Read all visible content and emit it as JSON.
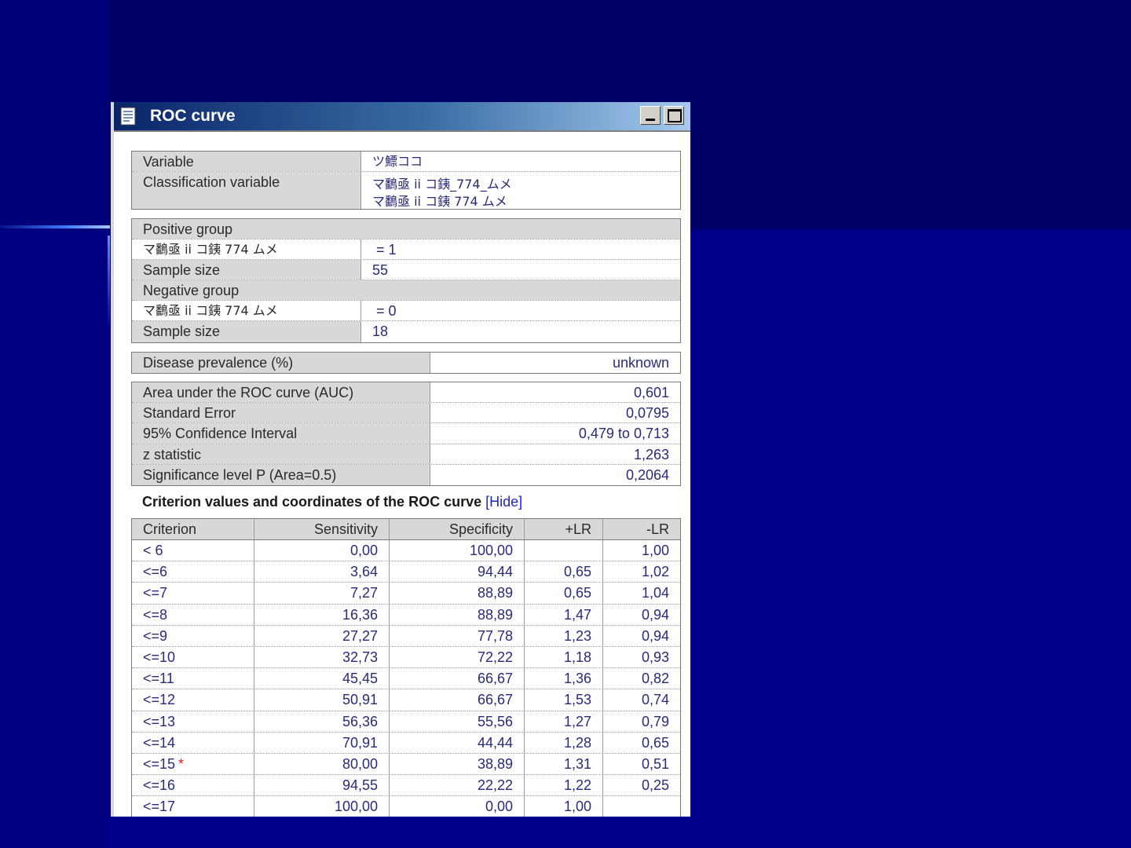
{
  "window": {
    "title": "ROC curve"
  },
  "info": {
    "variable_label": "Variable",
    "variable_value": "ツ鰾ココ",
    "class_label": "Classification variable",
    "class_value_1": "マ鷭亟 ii コ銕_774_ムメ",
    "class_value_2": "マ鷭亟 ii コ銕 774 ムメ"
  },
  "groups": {
    "positive_label": "Positive group",
    "positive_var": "マ鷭亟 ii コ銕 774 ムメ",
    "positive_cond": " = 1",
    "positive_size_label": "Sample size",
    "positive_size": "55",
    "negative_label": "Negative group",
    "negative_var": "マ鷭亟 ii コ銕 774 ムメ",
    "negative_cond": " = 0",
    "negative_size_label": "Sample size",
    "negative_size": "18"
  },
  "prevalence": {
    "label": "Disease prevalence (%)",
    "value": "unknown"
  },
  "stats": [
    {
      "label": "Area under the ROC curve (AUC)",
      "value": "0,601"
    },
    {
      "label": "Standard Error",
      "value": "0,0795"
    },
    {
      "label": "95% Confidence Interval",
      "value": "0,479 to 0,713"
    },
    {
      "label": "z statistic",
      "value": "1,263"
    },
    {
      "label": "Significance level P (Area=0.5)",
      "value": "0,2064"
    }
  ],
  "criterion_section": {
    "heading": "Criterion values and coordinates of the ROC curve",
    "hide_link": "[Hide]"
  },
  "criterion_table": {
    "headers": [
      "Criterion",
      "Sensitivity",
      "Specificity",
      "+LR",
      "-LR"
    ],
    "rows": [
      {
        "criterion": "< 6",
        "star": "",
        "sens": "0,00",
        "spec": "100,00",
        "plr": "",
        "nlr": "1,00"
      },
      {
        "criterion": "<=6",
        "star": "",
        "sens": "3,64",
        "spec": "94,44",
        "plr": "0,65",
        "nlr": "1,02"
      },
      {
        "criterion": "<=7",
        "star": "",
        "sens": "7,27",
        "spec": "88,89",
        "plr": "0,65",
        "nlr": "1,04"
      },
      {
        "criterion": "<=8",
        "star": "",
        "sens": "16,36",
        "spec": "88,89",
        "plr": "1,47",
        "nlr": "0,94"
      },
      {
        "criterion": "<=9",
        "star": "",
        "sens": "27,27",
        "spec": "77,78",
        "plr": "1,23",
        "nlr": "0,94"
      },
      {
        "criterion": "<=10",
        "star": "",
        "sens": "32,73",
        "spec": "72,22",
        "plr": "1,18",
        "nlr": "0,93"
      },
      {
        "criterion": "<=11",
        "star": "",
        "sens": "45,45",
        "spec": "66,67",
        "plr": "1,36",
        "nlr": "0,82"
      },
      {
        "criterion": "<=12",
        "star": "",
        "sens": "50,91",
        "spec": "66,67",
        "plr": "1,53",
        "nlr": "0,74"
      },
      {
        "criterion": "<=13",
        "star": "",
        "sens": "56,36",
        "spec": "55,56",
        "plr": "1,27",
        "nlr": "0,79"
      },
      {
        "criterion": "<=14",
        "star": "",
        "sens": "70,91",
        "spec": "44,44",
        "plr": "1,28",
        "nlr": "0,65"
      },
      {
        "criterion": "<=15",
        "star": "*",
        "sens": "80,00",
        "spec": "38,89",
        "plr": "1,31",
        "nlr": "0,51"
      },
      {
        "criterion": "<=16",
        "star": "",
        "sens": "94,55",
        "spec": "22,22",
        "plr": "1,22",
        "nlr": "0,25"
      },
      {
        "criterion": "<=17",
        "star": "",
        "sens": "100,00",
        "spec": "0,00",
        "plr": "1,00",
        "nlr": ""
      }
    ]
  }
}
